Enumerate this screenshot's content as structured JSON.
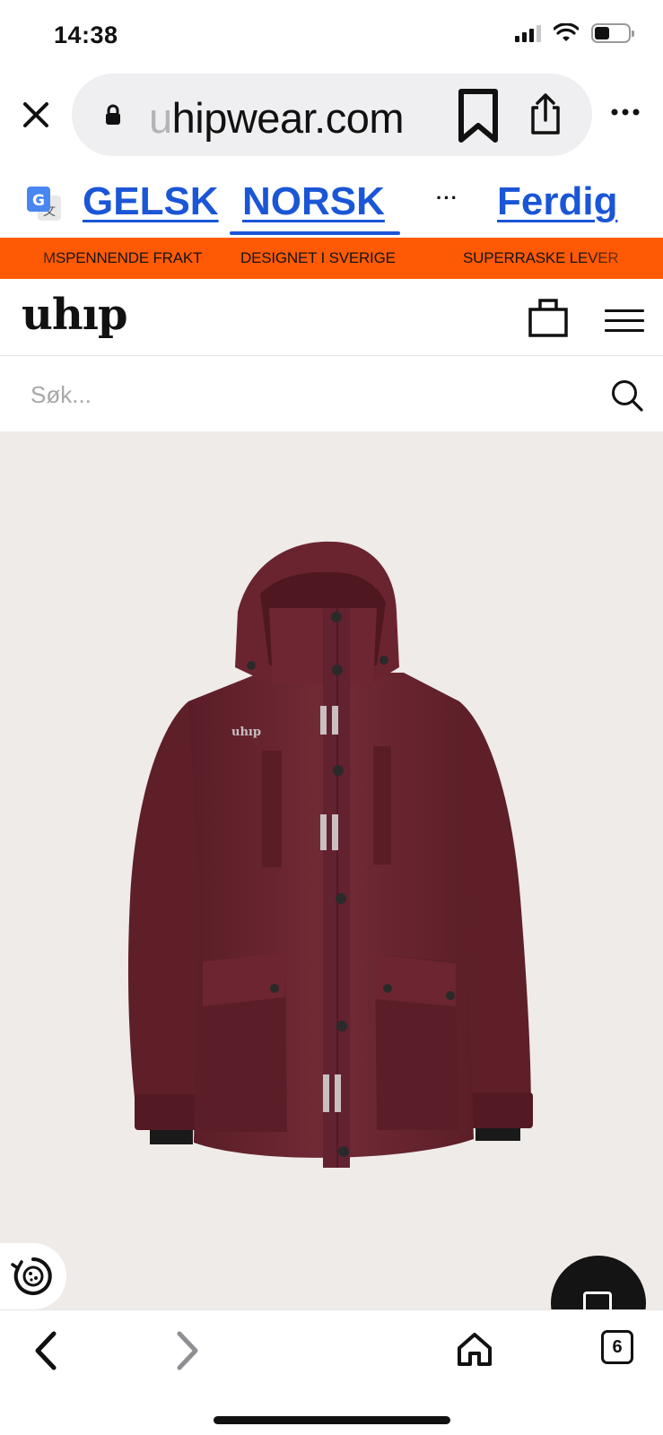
{
  "status_bar": {
    "time": "14:38",
    "icons": [
      "cellular-signal-icon",
      "wifi-icon",
      "battery-icon"
    ],
    "battery_level": 0.45
  },
  "browser": {
    "url_faded": "u",
    "url_main": "hipwear.com",
    "icons": [
      "close-icon",
      "lock-icon",
      "bookmark-icon",
      "share-icon",
      "more-icon"
    ]
  },
  "translate_bar": {
    "source_lang": "GELSK",
    "target_lang": "NORSK",
    "more": "···",
    "done": "Ferdig",
    "icon": "google-translate-icon",
    "link_color": "#1a56d6"
  },
  "promo": {
    "items": [
      "MSPENNENDE FRAKT",
      "DESIGNET I SVERIGE",
      "SUPERRASKE LEVER"
    ],
    "color": "#fe5a06"
  },
  "site": {
    "logo": "uhıp",
    "icons": [
      "shopping-bag-icon",
      "hamburger-menu-icon"
    ]
  },
  "search": {
    "placeholder": "Søk...",
    "value": "",
    "icon": "search-icon"
  },
  "product": {
    "image_label": "uhıp",
    "jacket_color": "#6b2631",
    "background_color": "#efebe9"
  },
  "floating": {
    "left_icon": "cookie-settings-icon",
    "right_icon": "chat-icon"
  },
  "toolbar": {
    "tabs_count": "6",
    "icons": [
      "back-arrow-icon",
      "forward-arrow-icon",
      "home-icon",
      "tabs-icon"
    ]
  }
}
